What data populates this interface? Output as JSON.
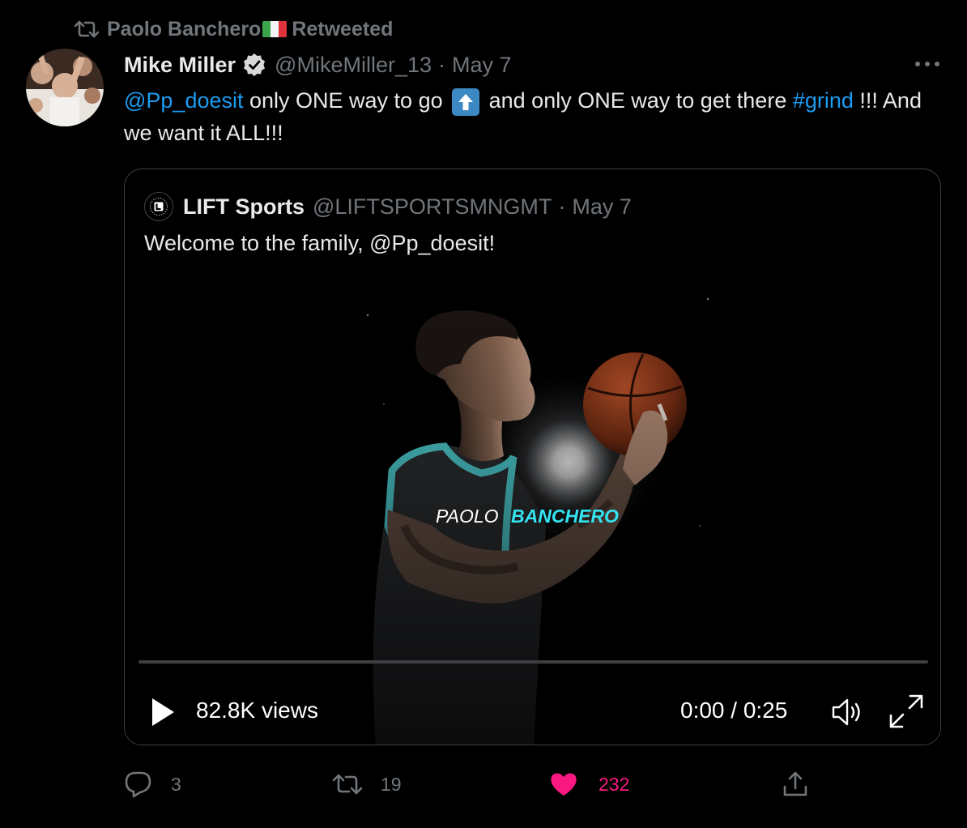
{
  "retweet_context": {
    "user": "Paolo Banchero",
    "flag": "italy-flag",
    "label": "Retweeted"
  },
  "tweet": {
    "author_name": "Mike Miller",
    "verified": true,
    "handle": "@MikeMiller_13",
    "separator": "·",
    "date": "May 7",
    "mention": "@Pp_doesit",
    "text_1": " only ONE way to go ",
    "emoji": "up-arrow-button",
    "text_2": " and only ONE way to get there ",
    "hashtag": "#grind",
    "text_3": " !!! And we want it ALL!!!"
  },
  "quote": {
    "author_name": "LIFT Sports",
    "handle": "@LIFTSPORTSMNGMT",
    "separator": "·",
    "date": "May 7",
    "text": "Welcome to the family, @Pp_doesit!",
    "video": {
      "overlay_first": "PAOLO ",
      "overlay_last": "BANCHERO",
      "views": "82.8K views",
      "time": "0:00 / 0:25",
      "progress": 0
    }
  },
  "actions": {
    "replies": "3",
    "retweets": "19",
    "likes": "232",
    "liked": true
  },
  "colors": {
    "accent": "#1d9bf0",
    "like": "#f91880",
    "muted": "#71767b",
    "teal": "#33e3f0"
  }
}
